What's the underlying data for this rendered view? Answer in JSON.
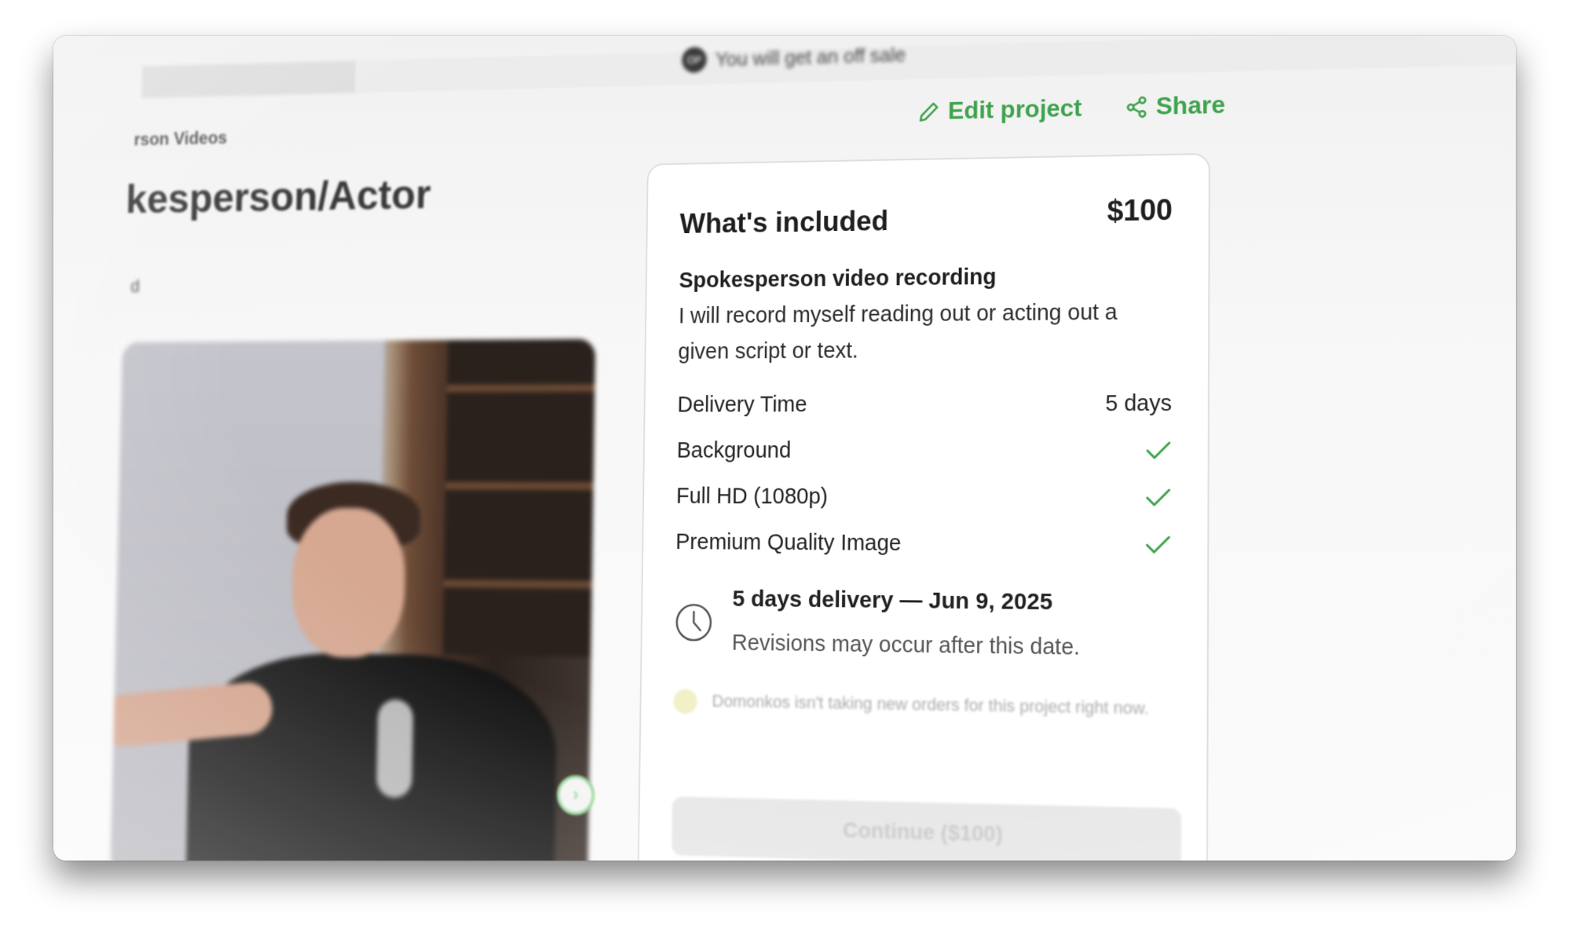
{
  "topbar": {
    "promo_icon": "OP",
    "promo_text": "You will get an off sale"
  },
  "project": {
    "breadcrumb": "rson Videos",
    "title": "kesperson/Actor",
    "subtitle": "d"
  },
  "actions": {
    "edit_label": "Edit project",
    "share_label": "Share",
    "accent_color": "#3fa34d"
  },
  "card": {
    "title": "What's included",
    "price": "$100",
    "package_name": "Spokesperson video recording",
    "package_description": "I will record myself reading out or acting out a given script or text.",
    "features": [
      {
        "label": "Delivery Time",
        "value": "5 days",
        "type": "text"
      },
      {
        "label": "Background",
        "value": "",
        "type": "check"
      },
      {
        "label": "Full HD (1080p)",
        "value": "",
        "type": "check"
      },
      {
        "label": "Premium Quality Image",
        "value": "",
        "type": "check"
      }
    ],
    "delivery": {
      "title": "5 days delivery — Jun 9, 2025",
      "subtitle": "Revisions may occur after this date."
    },
    "notice": "Domonkos isn't taking new orders for this project right now.",
    "continue_label": "Continue ($100)"
  },
  "carousel": {
    "next_icon": "chevron-right-icon"
  }
}
